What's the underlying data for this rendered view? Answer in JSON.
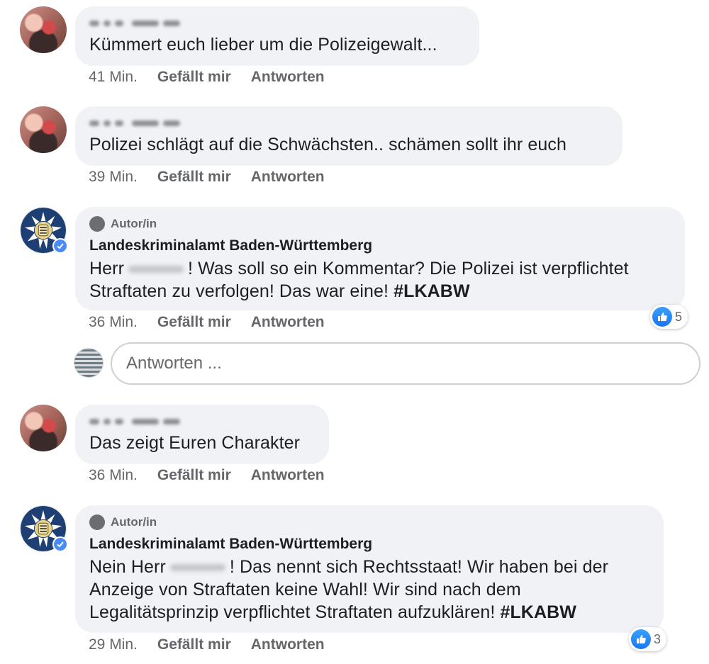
{
  "comments": [
    {
      "text": "Kümmert euch lieber um die Polizeigewalt...",
      "time": "41 Min.",
      "like_label": "Gefällt mir",
      "reply_label": "Antworten"
    },
    {
      "text": "Polizei schlägt auf die Schwächsten.. schämen sollt ihr euch",
      "time": "39 Min.",
      "like_label": "Gefällt mir",
      "reply_label": "Antworten"
    },
    {
      "author_badge": "Autor/in",
      "author": "Landeskriminalamt Baden-Württemberg",
      "text_a": "Herr",
      "text_b": "! Was soll so ein Kommentar? Die Polizei ist verpflichtet",
      "text_c": "Straftaten zu verfolgen! Das war eine! ",
      "hashtag": "#LKABW",
      "time": "36 Min.",
      "like_label": "Gefällt mir",
      "reply_label": "Antworten",
      "reaction_count": "5"
    },
    {
      "text": "Das zeigt Euren Charakter",
      "time": "36 Min.",
      "like_label": "Gefällt mir",
      "reply_label": "Antworten"
    },
    {
      "author_badge": "Autor/in",
      "author": "Landeskriminalamt Baden-Württemberg",
      "text_a": "Nein Herr",
      "text_b": "! Das nennt sich Rechtsstaat! Wir haben bei der",
      "text_c": "Anzeige von Straftaten keine Wahl! Wir sind nach dem",
      "text_d": "Legalitätsprinzip verpflichtet Straftaten aufzuklären! ",
      "hashtag": "#LKABW",
      "time": "29 Min.",
      "like_label": "Gefällt mir",
      "reply_label": "Antworten",
      "reaction_count": "3"
    }
  ],
  "reply_box": {
    "placeholder": "Antworten ..."
  },
  "colors": {
    "bubble": "#f0f2f5",
    "meta_text": "#65676b",
    "like_blue": "#1877f2",
    "verified": "#4a8bf5"
  }
}
